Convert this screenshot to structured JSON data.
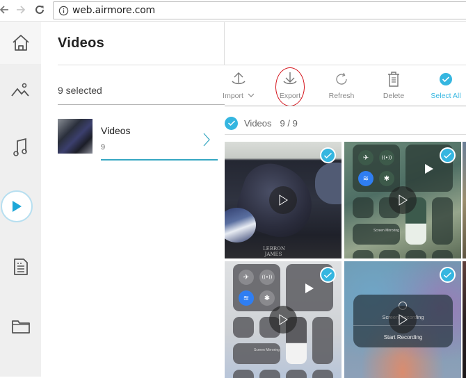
{
  "browser": {
    "url": "web.airmore.com",
    "back_icon": "arrow-left-icon",
    "forward_icon": "arrow-right-icon",
    "reload_icon": "reload-icon",
    "info_icon": "info-icon"
  },
  "sidebar": {
    "items": [
      {
        "name": "home",
        "icon": "home-icon",
        "active": false
      },
      {
        "name": "pictures",
        "icon": "mountain-icon",
        "active": false
      },
      {
        "name": "music",
        "icon": "music-note-icon",
        "active": false
      },
      {
        "name": "videos",
        "icon": "play-icon",
        "active": true
      },
      {
        "name": "documents",
        "icon": "document-icon",
        "active": false
      },
      {
        "name": "files",
        "icon": "folder-icon",
        "active": false
      }
    ]
  },
  "header": {
    "title": "Videos",
    "selected_text": "9 selected"
  },
  "toolbar": {
    "import_label": "Import",
    "export_label": "Export",
    "refresh_label": "Refresh",
    "delete_label": "Delete",
    "select_all_label": "Select All",
    "accent_color": "#35b6e0",
    "annotation_color": "#d4121a"
  },
  "albums": [
    {
      "name": "Videos",
      "count": "9"
    }
  ],
  "grid": {
    "title": "Videos",
    "count": "9 / 9",
    "thumbnails": [
      {
        "label": "sneakers-video",
        "selected": true,
        "text": "LEBRON JAMES"
      },
      {
        "label": "control-center-video-1",
        "selected": true,
        "text": "Screen Mirroring"
      },
      {
        "label": "control-center-video-2",
        "selected": true,
        "text": "Screen Mirroring"
      },
      {
        "label": "screen-recording-video",
        "selected": true,
        "text": "Screen Recording",
        "subtext": "Start Recording"
      }
    ]
  }
}
